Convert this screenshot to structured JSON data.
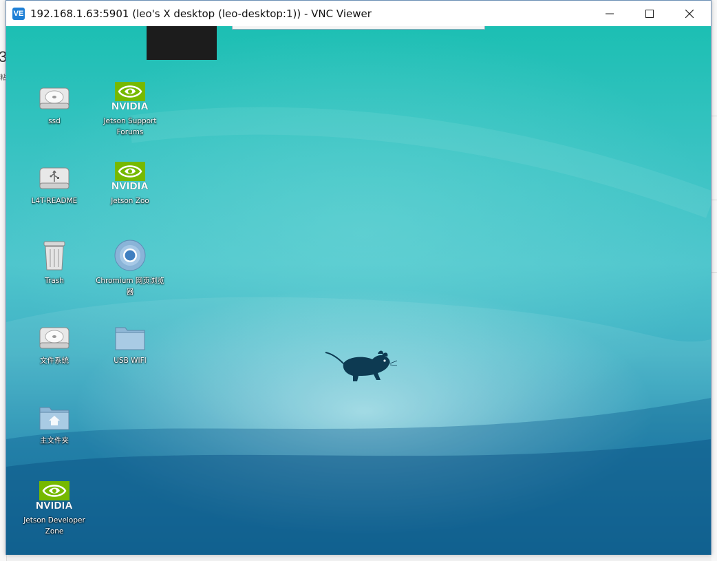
{
  "window": {
    "app_icon_text": "VE",
    "title": "192.168.1.63:5901 (leo's X desktop (leo-desktop:1)) - VNC Viewer",
    "controls": [
      "minimize",
      "maximize",
      "close"
    ]
  },
  "background_app": {
    "left_glyph": "3",
    "left_small_glyph": "粘"
  },
  "desktop": {
    "icons": [
      {
        "label": "ssd",
        "icon": "drive-icon"
      },
      {
        "label": "Jetson Support Forums",
        "icon": "nvidia-logo-icon",
        "brand": "NVIDIA"
      },
      {
        "label": "L4T-README",
        "icon": "usb-drive-icon"
      },
      {
        "label": "Jetson Zoo",
        "icon": "nvidia-logo-icon",
        "brand": "NVIDIA"
      },
      {
        "label": "Trash",
        "icon": "trash-icon"
      },
      {
        "label": "Chromium 网页浏览器",
        "icon": "chromium-icon"
      },
      {
        "label": "文件系统",
        "icon": "drive-icon"
      },
      {
        "label": "USB WIFI",
        "icon": "folder-icon"
      },
      {
        "label": "主文件夹",
        "icon": "home-folder-icon"
      },
      {
        "label": "Jetson Developer Zone",
        "icon": "nvidia-logo-icon",
        "brand": "NVIDIA"
      }
    ],
    "wallpaper": "xfce-mouse-icon"
  },
  "colors": {
    "nvidia_green": "#76b900",
    "desktop_top": "#1cbfb3",
    "desktop_bottom": "#0f6f9a",
    "mouse": "#0d3a52"
  }
}
